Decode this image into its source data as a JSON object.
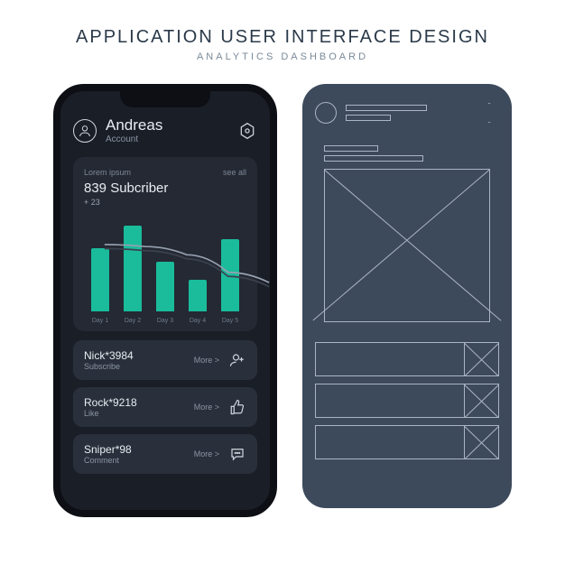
{
  "page": {
    "title": "APPLICATION USER INTERFACE DESIGN",
    "subtitle": "ANALYTICS DASHBOARD"
  },
  "header": {
    "username": "Andreas",
    "account_label": "Account"
  },
  "card": {
    "lorem": "Lorem ipsum",
    "see_all": "see all",
    "subscriber_line": "839 Subcriber",
    "delta": "+ 23"
  },
  "chart_data": {
    "type": "bar",
    "categories": [
      "Day 1",
      "Day 2",
      "Day 3",
      "Day 4",
      "Day 5"
    ],
    "values": [
      70,
      95,
      55,
      35,
      80
    ],
    "line_series": [
      72,
      70,
      62,
      45,
      35
    ],
    "ylim": [
      0,
      100
    ],
    "ylabel": "",
    "xlabel": "",
    "title": ""
  },
  "activity": [
    {
      "name": "Nick*3984",
      "action": "Subscribe",
      "more": "More >",
      "icon": "user-plus-icon"
    },
    {
      "name": "Rock*9218",
      "action": "Like",
      "more": "More >",
      "icon": "thumbs-up-icon"
    },
    {
      "name": "Sniper*98",
      "action": "Comment",
      "more": "More >",
      "icon": "comment-icon"
    }
  ],
  "colors": {
    "bg_dark": "#1a1e27",
    "card": "#242933",
    "row": "#2a303b",
    "accent": "#1abc9c",
    "wireframe_bg": "#3d4a5c",
    "stroke": "#aab5c3"
  }
}
